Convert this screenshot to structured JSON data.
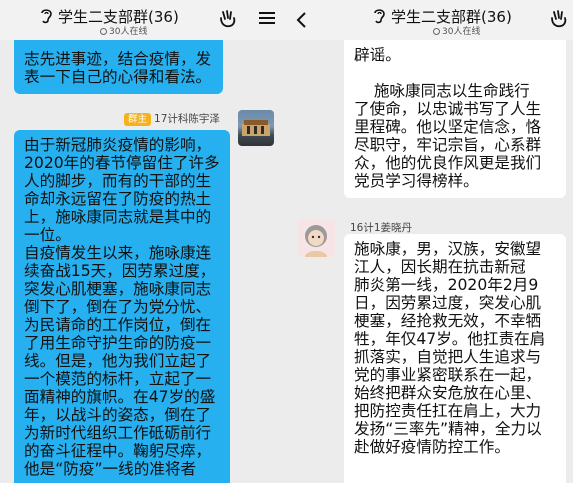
{
  "colors": {
    "bubble_self": "#26b0f0",
    "bubble_other": "#ffffff",
    "badge": "#f5b21c"
  },
  "icons": {
    "ear": "ear-icon",
    "emoji": "emoji-icon",
    "menu": "menu-icon",
    "back": "back-arrow-icon"
  },
  "left": {
    "header": {
      "title": "学生二支部群(36)",
      "online": "30人在线"
    },
    "msg_top": {
      "lines": [
        "志先进事迹，结合疫情，发",
        "表一下自己的心得和看法。"
      ]
    },
    "msg_main": {
      "badge": "群主",
      "sender": "17计科陈宇泽",
      "lines": [
        "由于新冠肺炎疫情的影响，",
        "2020年的春节停留住了许多",
        "人的脚步，而有的干部的生",
        "命却永远留在了防疫的热土",
        "上，施咏康同志就是其中的",
        "一位。",
        "自疫情发生以来，施咏康连",
        "续奋战15天，因劳累过度，",
        "突发心肌梗塞，施咏康同志",
        "倒下了，倒在了为党分忧、",
        "为民请命的工作岗位，倒在",
        "了用生命守护生命的防疫一",
        "线。但是，他为我们立起了",
        "一个模范的标杆，立起了一",
        "面精神的旗帜。在47岁的盛",
        "年，以战斗的姿态，倒在了",
        "为新时代组织工作砥砺前行",
        "的奋斗征程中。鞠躬尽瘁，",
        "他是“防疫”一线的准将者"
      ]
    }
  },
  "right": {
    "header": {
      "title": "学生二支部群(36)",
      "online": "30人在线"
    },
    "msg_top": {
      "lines": [
        "辟谣。",
        "",
        "    施咏康同志以生命践行",
        "了使命，以忠诚书写了人生",
        "里程碑。他以坚定信念，恪",
        "尽职守，牢记宗旨，心系群",
        "众，他的优良作风更是我们",
        "党员学习得榜样。"
      ]
    },
    "msg_second": {
      "sender": "16计1姜晓丹",
      "lines": [
        "施咏康，男，汉族，安徽望",
        "江人，因长期在抗击新冠",
        "肺炎第一线，2020年2月9",
        "日，因劳累过度，突发心肌",
        "梗塞，经抢救无效，不幸牺",
        "牲，年仅47岁。他扛责在肩",
        "抓落实，自觉把人生追求与",
        "党的事业紧密联系在一起，",
        "始终把群众安危放在心里、",
        "把防控责任扛在肩上，大力",
        "发扬“三率先”精神，全力以",
        "赴做好疫情防控工作。"
      ]
    }
  }
}
